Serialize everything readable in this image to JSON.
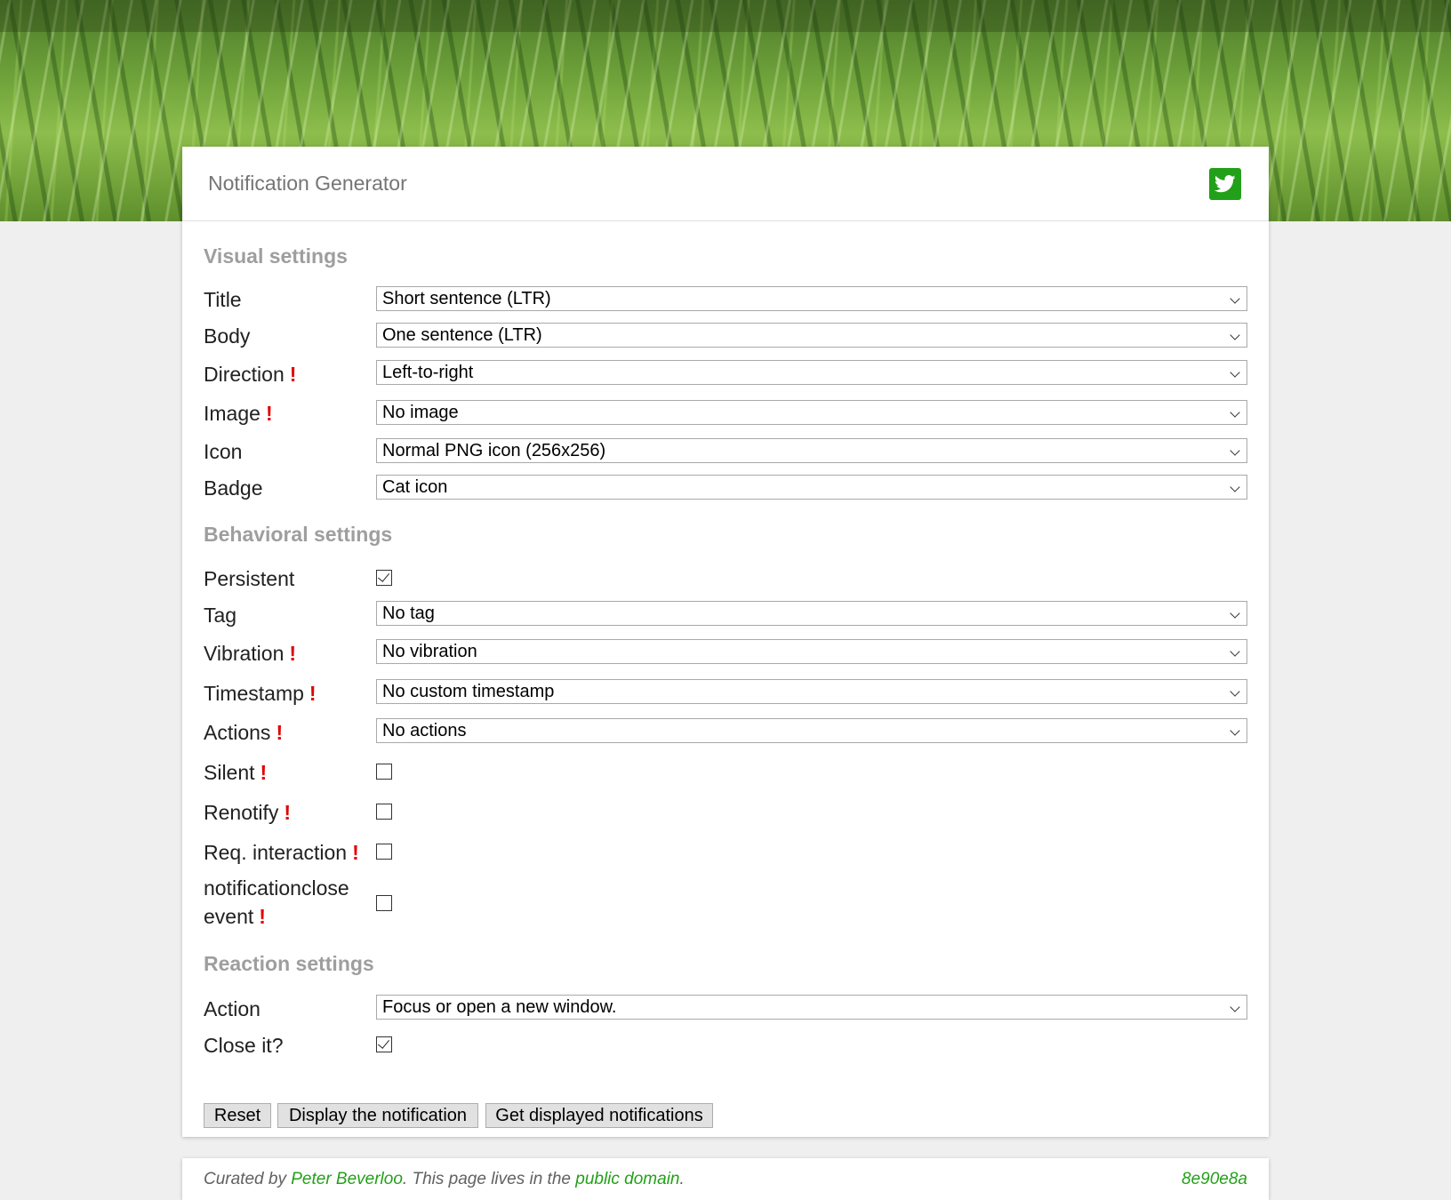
{
  "app_title": "Notification Generator",
  "twitter_icon": "twitter-bird-icon",
  "accent_color": "#23a019",
  "warning_mark": "!",
  "sections": {
    "visual": "Visual settings",
    "behavioral": "Behavioral settings",
    "reaction": "Reaction settings"
  },
  "visual": {
    "title": {
      "label": "Title",
      "value": "Short sentence (LTR)"
    },
    "body": {
      "label": "Body",
      "value": "One sentence (LTR)"
    },
    "direction": {
      "label": "Direction",
      "value": "Left-to-right"
    },
    "image": {
      "label": "Image",
      "value": "No image"
    },
    "icon": {
      "label": "Icon",
      "value": "Normal PNG icon (256x256)"
    },
    "badge": {
      "label": "Badge",
      "value": "Cat icon"
    }
  },
  "behavioral": {
    "persistent": {
      "label": "Persistent",
      "checked": true
    },
    "tag": {
      "label": "Tag",
      "value": "No tag"
    },
    "vibration": {
      "label": "Vibration",
      "value": "No vibration"
    },
    "timestamp": {
      "label": "Timestamp",
      "value": "No custom timestamp"
    },
    "actions": {
      "label": "Actions",
      "value": "No actions"
    },
    "silent": {
      "label": "Silent",
      "checked": false
    },
    "renotify": {
      "label": "Renotify",
      "checked": false
    },
    "req_interaction": {
      "label": "Req. interaction",
      "checked": false
    },
    "close_event": {
      "label_line1": "notificationclose",
      "label_line2": "event",
      "checked": false
    }
  },
  "reaction": {
    "action": {
      "label": "Action",
      "value": "Focus or open a new window."
    },
    "close_it": {
      "label": "Close it?",
      "checked": true
    }
  },
  "buttons": {
    "reset": "Reset",
    "display": "Display the notification",
    "get_displayed": "Get displayed notifications"
  },
  "footer": {
    "curated_by": "Curated by",
    "author": "Peter Beverloo",
    "lives_in": ". This page lives in the",
    "license": "public domain",
    "period": ".",
    "commit": "8e90e8a"
  }
}
